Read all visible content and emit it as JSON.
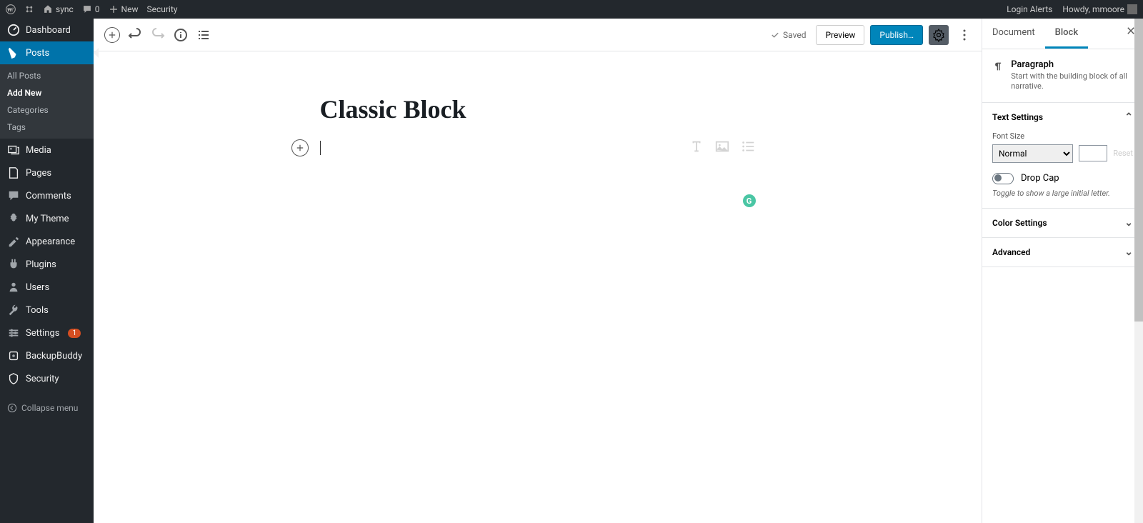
{
  "adminbar": {
    "site": "sync",
    "comments": "0",
    "new": "New",
    "security": "Security",
    "alerts": "Login Alerts",
    "howdy": "Howdy, mmoore"
  },
  "sidebar": {
    "dashboard": "Dashboard",
    "posts": "Posts",
    "sub": {
      "all": "All Posts",
      "add": "Add New",
      "cat": "Categories",
      "tags": "Tags"
    },
    "media": "Media",
    "pages": "Pages",
    "comments": "Comments",
    "mytheme": "My Theme",
    "appearance": "Appearance",
    "plugins": "Plugins",
    "users": "Users",
    "tools": "Tools",
    "settings": "Settings",
    "settings_badge": "1",
    "backup": "BackupBuddy",
    "security2": "Security",
    "collapse": "Collapse menu"
  },
  "toolbar": {
    "saved": "Saved",
    "preview": "Preview",
    "publish": "Publish…"
  },
  "doc": {
    "title": "Classic Block"
  },
  "inspector": {
    "tab_doc": "Document",
    "tab_block": "Block",
    "btype": "Paragraph",
    "bdesc": "Start with the building block of all narrative.",
    "p1": "Text Settings",
    "fontlabel": "Font Size",
    "fontsize": "Normal",
    "reset": "Reset",
    "dropcap": "Drop Cap",
    "drophint": "Toggle to show a large initial letter.",
    "p2": "Color Settings",
    "p3": "Advanced"
  }
}
